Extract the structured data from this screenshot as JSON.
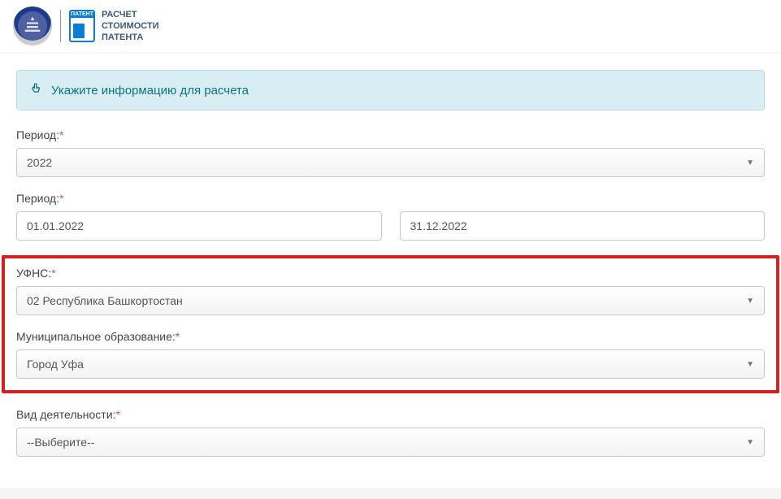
{
  "header": {
    "patent_icon_label": "ПАТЕНТ",
    "title_line1": "РАСЧЕТ",
    "title_line2": "СТОИМОСТИ",
    "title_line3": "ПАТЕНТА"
  },
  "info_panel": {
    "text": "Укажите информацию для расчета"
  },
  "form": {
    "period_year": {
      "label": "Период:",
      "value": "2022"
    },
    "period_dates": {
      "label": "Период:",
      "from": "01.01.2022",
      "to": "31.12.2022"
    },
    "ufns": {
      "label": "УФНС:",
      "value": "02 Республика Башкортостан"
    },
    "municipality": {
      "label": "Муниципальное образование:",
      "value": "Город Уфа"
    },
    "activity": {
      "label": "Вид деятельности:",
      "value": "--Выберите--"
    }
  },
  "required_marker": "*"
}
